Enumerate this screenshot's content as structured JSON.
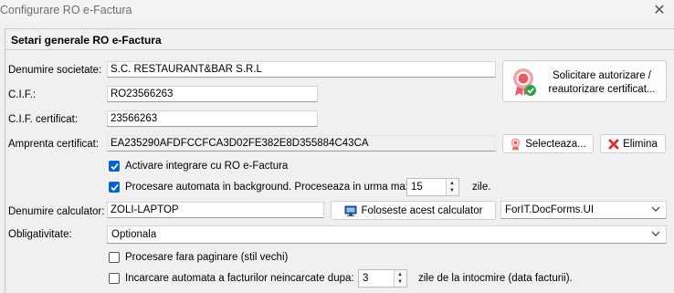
{
  "window": {
    "title": "Configurare RO e-Factura",
    "close_glyph": "✕"
  },
  "group": {
    "title": "Setari generale RO e-Factura"
  },
  "fields": {
    "company_label": "Denumire societate:",
    "company_value": "S.C. RESTAURANT&BAR S.R.L",
    "cif_label": "C.I.F.:",
    "cif_value": "RO23566263",
    "cert_cif_label": "C.I.F. certificat:",
    "cert_cif_value": "23566263",
    "fingerprint_label": "Amprenta certificat:",
    "fingerprint_value": "EA235290AFDFCCFCA3D02FE382E8D355884C43CA",
    "computer_label": "Denumire calculator:",
    "computer_value": "ZOLI-LAPTOP",
    "obligation_label": "Obligativitate:"
  },
  "buttons": {
    "authorize_line1": "Solicitare autorizare /",
    "authorize_line2": "reautorizare certificat...",
    "select_label": "Selecteaza...",
    "remove_label": "Elimina",
    "use_computer_label": "Foloseste acest calculator"
  },
  "options": {
    "enable_integration": {
      "label": "Activare integrare cu RO e-Factura",
      "checked": true
    },
    "auto_processing": {
      "label": "Procesare automata in background. Proceseaza in urma max.",
      "checked": true,
      "days": "15",
      "unit": "zile."
    },
    "no_paging": {
      "label": "Procesare fara paginare (stil vechi)",
      "checked": false
    },
    "auto_upload": {
      "label": "Incarcare automata a facturilor neincarcate dupa:",
      "checked": false,
      "days": "3",
      "unit": "zile de la intocmire (data facturii)."
    }
  },
  "selects": {
    "form_module": "ForIT.DocForms.UI",
    "obligation": "Optionala"
  },
  "icons": {
    "certificate": "certificate-icon",
    "remove": "remove-icon",
    "computer": "computer-icon"
  },
  "colors": {
    "checkbox_accent": "#0a64c8",
    "remove_red": "#d9343a",
    "cert_red": "#e0606a",
    "verified_green": "#2e9e4a"
  }
}
